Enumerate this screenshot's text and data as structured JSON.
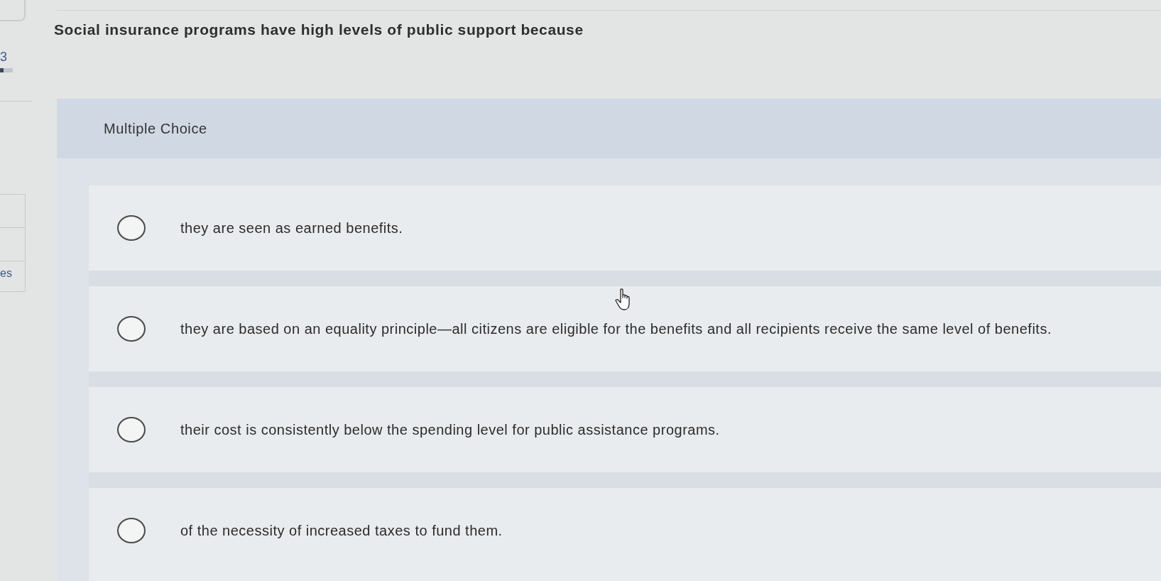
{
  "sidebar": {
    "items": [
      {
        "text": "3"
      },
      {
        "text": "es"
      }
    ]
  },
  "question": {
    "text": "Social insurance programs have high levels of public support because"
  },
  "answer_panel": {
    "header": "Multiple Choice",
    "options": [
      {
        "label": "they are seen as earned benefits.",
        "selected": false
      },
      {
        "label": "they are based on an equality principle—all citizens are eligible for the benefits and all recipients receive the same level of benefits.",
        "selected": false
      },
      {
        "label": "their cost is consistently below the spending level for public assistance programs.",
        "selected": false
      },
      {
        "label": "of the necessity of increased taxes to fund them.",
        "selected": false
      }
    ]
  }
}
